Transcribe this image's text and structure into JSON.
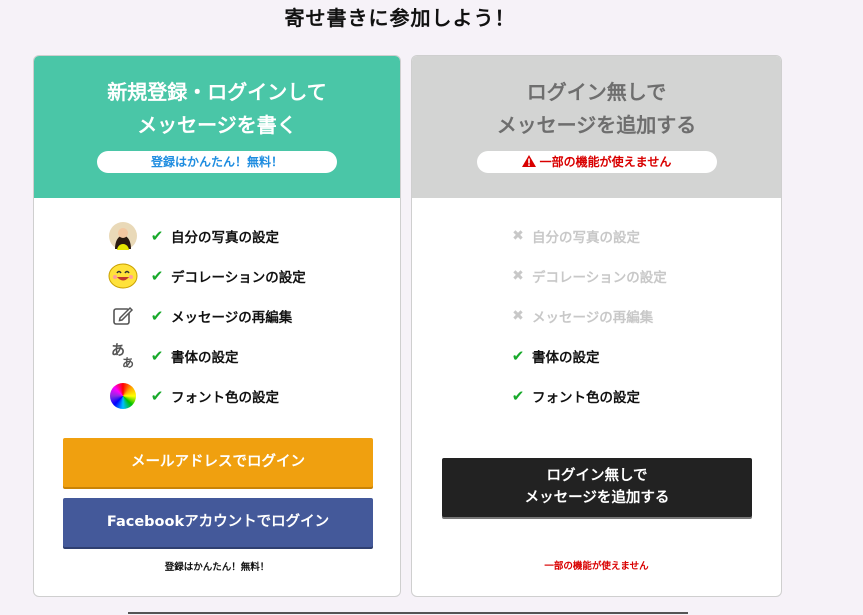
{
  "page": {
    "title": "寄せ書きに参加しよう！"
  },
  "left_card": {
    "heading_line1": "新規登録・ログインして",
    "heading_line2": "メッセージを書く",
    "pill": "登録はかんたん！無料！",
    "features": [
      {
        "icon": "photo-avatar-icon",
        "label": "自分の写真の設定",
        "enabled": true
      },
      {
        "icon": "smiley-face-icon",
        "label": "デコレーションの設定",
        "enabled": true
      },
      {
        "icon": "edit-pencil-icon",
        "label": "メッセージの再編集",
        "enabled": true
      },
      {
        "icon": "font-style-icon",
        "label": "書体の設定",
        "enabled": true
      },
      {
        "icon": "color-wheel-icon",
        "label": "フォント色の設定",
        "enabled": true
      }
    ],
    "mail_button": "メールアドレスでログイン",
    "facebook_button": "Facebookアカウントでログイン",
    "note": "登録はかんたん！無料！"
  },
  "right_card": {
    "heading_line1": "ログイン無しで",
    "heading_line2": "メッセージを追加する",
    "pill": "一部の機能が使えません",
    "features": [
      {
        "label": "自分の写真の設定",
        "enabled": false
      },
      {
        "label": "デコレーションの設定",
        "enabled": false
      },
      {
        "label": "メッセージの再編集",
        "enabled": false
      },
      {
        "label": "書体の設定",
        "enabled": true
      },
      {
        "label": "フォント色の設定",
        "enabled": true
      }
    ],
    "guest_button_line1": "ログイン無しで",
    "guest_button_line2": "メッセージを追加する",
    "note": "一部の機能が使えません"
  },
  "icons": {
    "check": "✔",
    "cross": "✖",
    "warning": "warning-triangle-icon"
  },
  "colors": {
    "accent_green": "#4ac6a7",
    "disabled_gray": "#d3d4d3",
    "mail_orange": "#f0a00f",
    "facebook_blue": "#44599a",
    "guest_black": "#222222",
    "warning_red": "#d90000",
    "check_green": "#17a92a"
  }
}
